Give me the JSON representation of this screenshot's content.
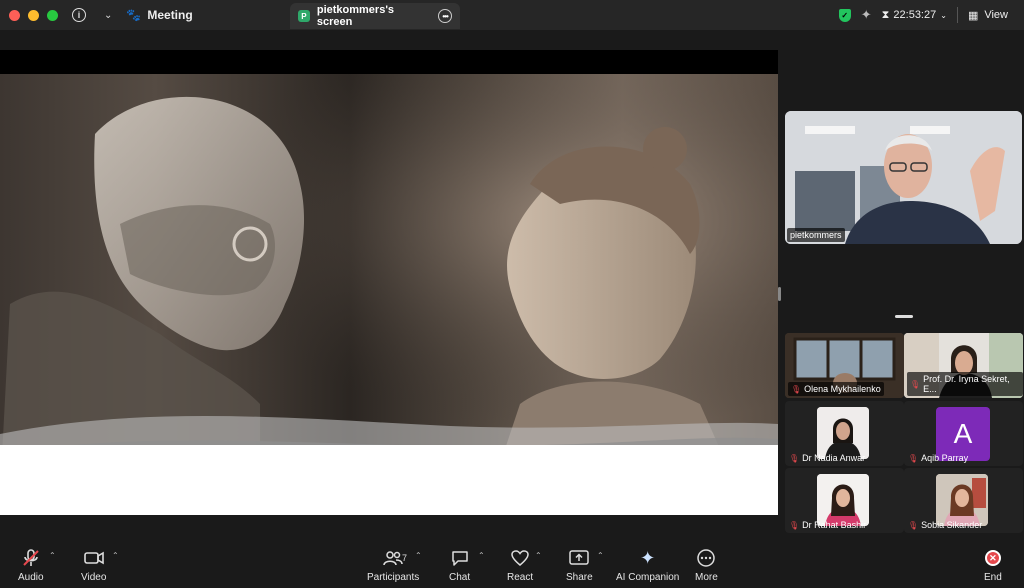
{
  "titlebar": {
    "meeting_label": "Meeting",
    "screen_tab_label": "pietkommers's screen",
    "screen_tab_badge": "P",
    "time": "22:53:27",
    "view_label": "View"
  },
  "active_speaker": {
    "name": "pietkommers"
  },
  "participants": [
    {
      "name": "Olena Mykhailenko",
      "muted": true,
      "kind": "video"
    },
    {
      "name": "Prof. Dr. Iryna Sekret, E...",
      "muted": true,
      "kind": "video"
    },
    {
      "name": "Dr Nadia Anwar",
      "muted": true,
      "kind": "photo"
    },
    {
      "name": "Aqib Parray",
      "muted": true,
      "kind": "letter",
      "letter": "A",
      "color": "#7d2ab8"
    },
    {
      "name": "Dr Rahat Bashir",
      "muted": true,
      "kind": "photo"
    },
    {
      "name": "Sobia Sikander",
      "muted": true,
      "kind": "photo"
    }
  ],
  "toolbar": {
    "audio": "Audio",
    "video": "Video",
    "participants": "Participants",
    "participants_count": "7",
    "chat": "Chat",
    "react": "React",
    "share": "Share",
    "ai_companion": "AI Companion",
    "more": "More",
    "end": "End"
  },
  "colors": {
    "end_red": "#e5484d",
    "secure_green": "#22c55e",
    "avatar_purple": "#7d2ab8"
  }
}
